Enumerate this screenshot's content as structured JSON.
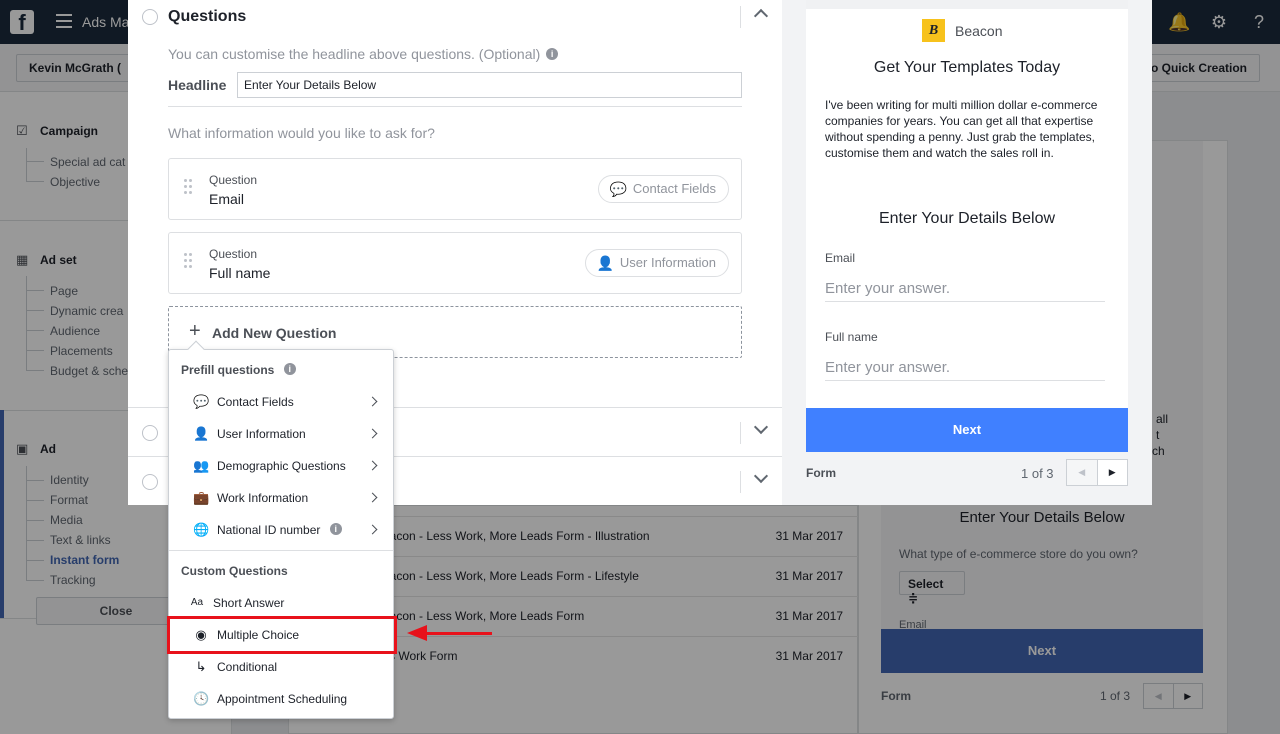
{
  "topbar": {
    "app_title": "Ads Ma"
  },
  "subbar": {
    "account": "Kevin McGrath (",
    "quick_creation": "o Quick Creation"
  },
  "leftnav": {
    "campaign": {
      "title": "Campaign",
      "items": [
        "Special ad cat",
        "Objective"
      ]
    },
    "adset": {
      "title": "Ad set",
      "items": [
        "Page",
        "Dynamic crea",
        "Audience",
        "Placements",
        "Budget & sche"
      ]
    },
    "ad": {
      "title": "Ad",
      "items": [
        "Identity",
        "Format",
        "Media",
        "Text & links",
        "Instant form",
        "Tracking"
      ],
      "active": "Instant form"
    },
    "close_label": "Close"
  },
  "background_list": {
    "rows": [
      {
        "name": "eacon - Less Work, More Leads Form - Illustration",
        "date": "31 Mar 2017"
      },
      {
        "name": "eacon - Less Work, More Leads Form - Lifestyle",
        "date": "31 Mar 2017"
      },
      {
        "name": "eacon - Less Work, More Leads Form",
        "date": "31 Mar 2017"
      },
      {
        "name": "ss Work Form",
        "date": "31 Mar 2017"
      }
    ]
  },
  "background_preview": {
    "title": "Enter Your Details Below",
    "question": "What type of e-commerce store do you own?",
    "select_label": "Select ≑",
    "email_label": "Email",
    "next_label": "Next",
    "form_label": "Form",
    "page": "1 of 3",
    "text_fragment": [
      "all",
      "t",
      "ch"
    ]
  },
  "questions": {
    "title": "Questions",
    "description": "You can customise the headline above questions. (Optional)",
    "headline_label": "Headline",
    "headline_value": "Enter Your Details Below",
    "ask_label": "What information would you like to ask for?",
    "cards": [
      {
        "label": "Question",
        "value": "Email",
        "tag": "Contact Fields"
      },
      {
        "label": "Question",
        "value": "Full name",
        "tag": "User Information"
      }
    ],
    "add_label": "Add New Question"
  },
  "preview": {
    "brand": "Beacon",
    "title": "Get Your Templates Today",
    "body": "I've been writing for multi million dollar e-commerce companies for years. You can get all that expertise without spending a penny. Just grab the templates, customise them and watch the sales roll in.",
    "subtitle": "Enter Your Details Below",
    "fields": [
      {
        "label": "Email",
        "placeholder": "Enter your answer."
      },
      {
        "label": "Full name",
        "placeholder": "Enter your answer."
      }
    ],
    "next_label": "Next",
    "form_label": "Form",
    "page": "1 of 3"
  },
  "dropdown": {
    "prefill_title": "Prefill questions",
    "prefill_items": [
      {
        "label": "Contact Fields",
        "icon": "chat-icon"
      },
      {
        "label": "User Information",
        "icon": "person-icon"
      },
      {
        "label": "Demographic Questions",
        "icon": "group-icon"
      },
      {
        "label": "Work Information",
        "icon": "briefcase-icon"
      },
      {
        "label": "National ID number",
        "icon": "globe-icon"
      }
    ],
    "custom_title": "Custom Questions",
    "custom_items": [
      {
        "label": "Short Answer",
        "icon": "text-icon",
        "icon_text": "Aa"
      },
      {
        "label": "Multiple Choice",
        "icon": "radio-icon"
      },
      {
        "label": "Conditional",
        "icon": "branch-icon"
      },
      {
        "label": "Appointment Scheduling",
        "icon": "clock-icon"
      }
    ],
    "highlighted": "Multiple Choice"
  },
  "colors": {
    "accent": "#4267b2",
    "preview_button": "#4080ff",
    "annotation": "#e8121b"
  }
}
